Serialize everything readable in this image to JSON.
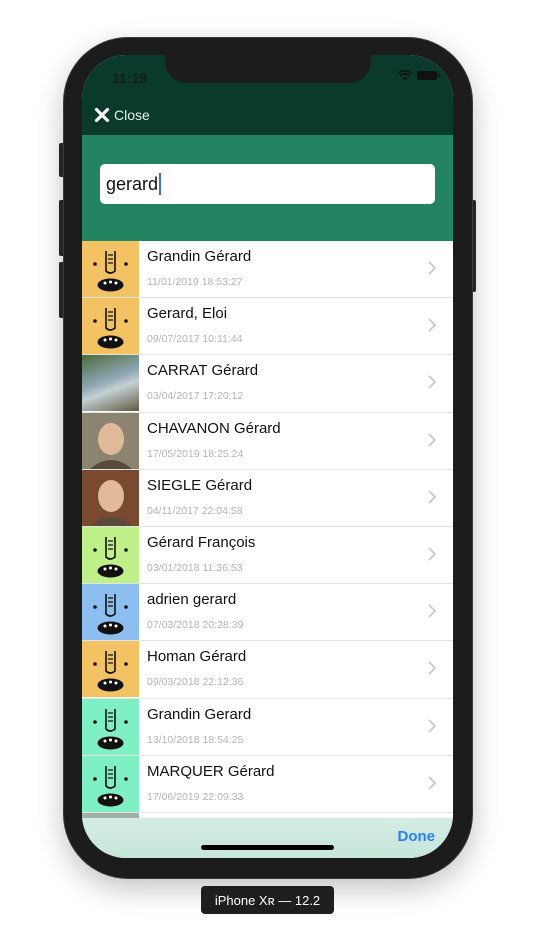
{
  "status_bar": {
    "time": "11:19"
  },
  "nav": {
    "close_label": "Close"
  },
  "search": {
    "value": "gerard"
  },
  "contacts": [
    {
      "name": "Grandin Gérard",
      "date": "11/01/2019 18:53:27",
      "avatar": "cartoon-face",
      "avatar_color": "#f3c262"
    },
    {
      "name": "Gerard, Eloi",
      "date": "09/07/2017 10:11:44",
      "avatar": "cartoon-face",
      "avatar_color": "#f3c262"
    },
    {
      "name": "CARRAT Gérard",
      "date": "03/04/2017 17:20:12",
      "avatar": "photo-landscape",
      "avatar_color": "#7b8b6a"
    },
    {
      "name": "CHAVANON Gérard",
      "date": "17/05/2019 18:25:24",
      "avatar": "photo-portrait",
      "avatar_color": "#8a8470"
    },
    {
      "name": "SIEGLE Gérard",
      "date": "04/11/2017 22:04:58",
      "avatar": "photo-portrait",
      "avatar_color": "#7a4a30"
    },
    {
      "name": "Gérard François",
      "date": "03/01/2018 11:36:53",
      "avatar": "cartoon-face",
      "avatar_color": "#bff08a"
    },
    {
      "name": "adrien gerard",
      "date": "07/03/2018 20:28:39",
      "avatar": "cartoon-face",
      "avatar_color": "#8cbef0"
    },
    {
      "name": "Homan Gérard",
      "date": "09/03/2018 22:12:36",
      "avatar": "cartoon-face",
      "avatar_color": "#f3c262"
    },
    {
      "name": "Grandin Gerard",
      "date": "13/10/2018 18:54:25",
      "avatar": "cartoon-face",
      "avatar_color": "#7ef0c4"
    },
    {
      "name": "MARQUER Gérard",
      "date": "17/06/2019 22:09:33",
      "avatar": "cartoon-face",
      "avatar_color": "#7ef0c4"
    }
  ],
  "toolbar": {
    "done_label": "Done"
  },
  "device_label": "iPhone Xʀ — 12.2",
  "colors": {
    "nav_bg": "#0a3a2b",
    "search_bg": "#238462",
    "accent": "#2b7ef5",
    "caret": "#3b6ff0"
  }
}
